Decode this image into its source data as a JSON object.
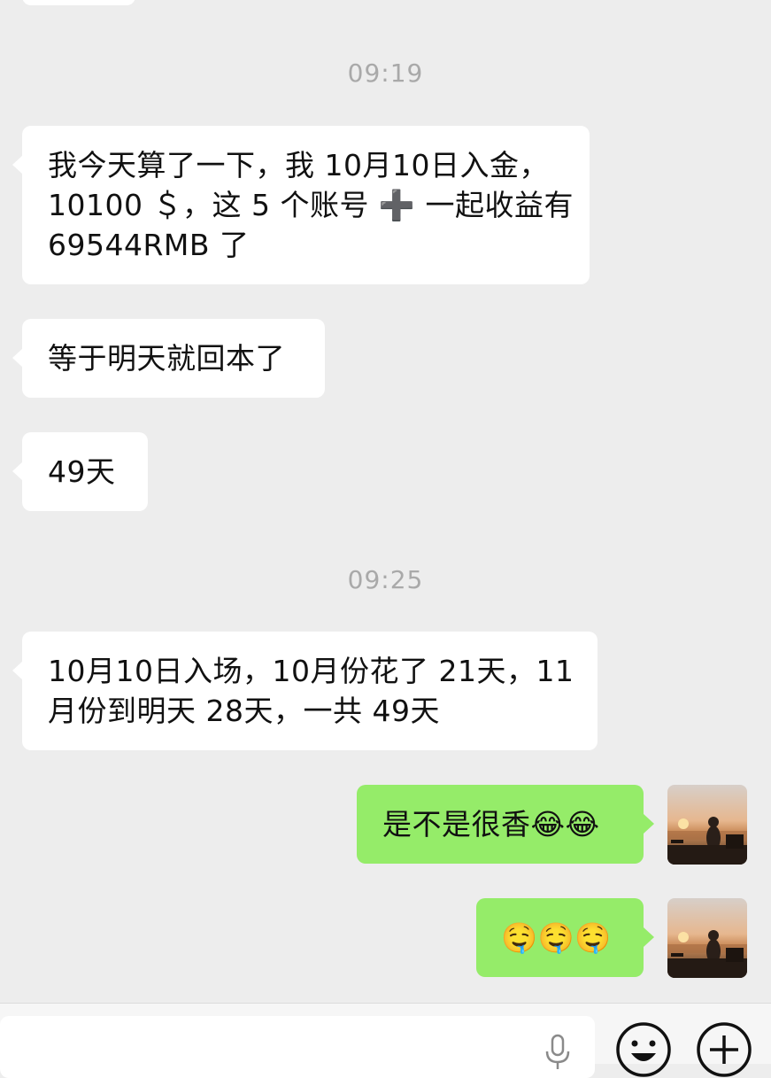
{
  "chat": {
    "timestamps": [
      "09:19",
      "09:25"
    ],
    "messages": [
      {
        "side": "left",
        "lines": [
          "我今天算了一下，我 10月10日入金，",
          "10100 ＄，这 5 个账号 ➕ 一起收益有",
          "69544RMB 了"
        ]
      },
      {
        "side": "left",
        "text": "等于明天就回本了"
      },
      {
        "side": "left",
        "text": "49天"
      },
      {
        "side": "left",
        "lines": [
          "10月10日入场，10月份花了 21天，11",
          "月份到明天 28天，一共 49天"
        ]
      },
      {
        "side": "right",
        "text": "是不是很香",
        "emoji": "😂😂"
      },
      {
        "side": "right",
        "emoji": "🤤🤤🤤"
      }
    ]
  },
  "icons": {
    "plus_sign": "➕",
    "voice": "microphone-icon",
    "emoji_button": "smiley-icon",
    "more": "plus-circle-icon"
  },
  "colors": {
    "background": "#ededed",
    "incoming_bubble": "#ffffff",
    "outgoing_bubble": "#95ec69",
    "timestamp": "#a9a9a9"
  }
}
